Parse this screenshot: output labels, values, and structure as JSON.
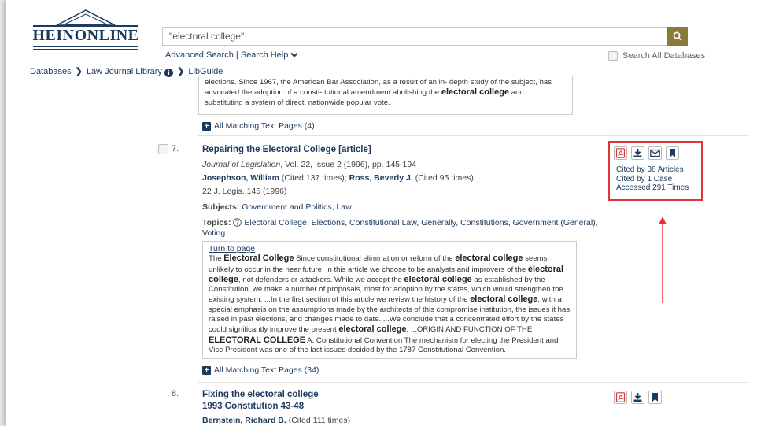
{
  "header": {
    "logo_text": "HEINONLINE",
    "search_value": "\"electoral college\"",
    "advanced_search": "Advanced Search",
    "link_separator": "|",
    "search_help": "Search Help",
    "search_all_label": "Search All Databases"
  },
  "breadcrumb": {
    "databases": "Databases",
    "library": "Law Journal Library",
    "libguide": "LibGuide"
  },
  "prev_result": {
    "snippet_line1": "elections. Since 1967, the American Bar Association, as a result of an in- depth study of the subject, has",
    "snippet_line2": "advocated the adoption of a consti- tutional amendment abolishing the",
    "snippet_kw": "electoral college",
    "snippet_line2b": "and",
    "snippet_line3": "substituting a system of direct, nationwide popular vote.",
    "more": "All Matching Text Pages (4)"
  },
  "result7": {
    "number": "7.",
    "title": "Repairing the Electoral College [article]",
    "journal": "Journal of Legislation",
    "journal_details": ", Vol. 22, Issue 2 (1996), pp. 145-194",
    "author1": "Josephson, William",
    "author1_cited": "(Cited 137 times);",
    "author2": "Ross, Beverly J.",
    "author2_cited": "(Cited 95 times)",
    "citation": "22 J. Legis. 145 (1996)",
    "subjects_label": "Subjects:",
    "subjects": "Government and Politics, Law",
    "topics_label": "Topics:",
    "topics_line1": "Electoral College, Elections, Constitutional Law, Generally, Constitutions, Government (General),",
    "topics_line2": "Voting",
    "turn_to_page": "Turn to page",
    "snippet": [
      {
        "t": "The "
      },
      {
        "k": "Electoral College"
      },
      {
        "t": " Since constitutional elimination or reform of the "
      },
      {
        "k": "electoral college"
      },
      {
        "t": " seems unlikely to occur in the near future, in this article we choose to be analysts and improvers of the "
      },
      {
        "k": "electoral college"
      },
      {
        "t": ", not defenders or attackers. While we accept the "
      },
      {
        "k": "electoral college"
      },
      {
        "t": " as established by the Constitution, we make a number of proposals, most for adoption by the states, which would strengthen the existing system. ...In the first section of this article we review the history of the "
      },
      {
        "k": "electoral college"
      },
      {
        "t": ", with a special emphasis on the assumptions made by the architects of this compromise institution, the issues it has raised in past elections, and changes made to date. ...We conclude that a concentrated effort by the states could significantly improve the present "
      },
      {
        "k": "electoral college"
      },
      {
        "t": ". ...ORIGIN AND FUNCTION OF THE "
      },
      {
        "k": "ELECTORAL COLLEGE"
      },
      {
        "t": " A. Constitutional Convention The mechanism for electing the President and Vice President was one of the last issues decided by the 1787 Constitutional Convention."
      }
    ],
    "more": "All Matching Text Pages (34)",
    "cited_articles": "Cited by 38 Articles",
    "cited_case": "Cited by 1 Case",
    "accessed": "Accessed 291 Times"
  },
  "result8": {
    "number": "8.",
    "title": "Fixing the electoral college",
    "subtitle": "1993 Constitution 43-48",
    "author": "Bernstein, Richard B.",
    "author_cited": "(Cited 111 times)"
  },
  "colors": {
    "brand": "#1c3a5c",
    "search_button": "#8a7a3a",
    "highlight": "#d9353a",
    "pdf_icon": "#d9353a"
  },
  "icons": [
    "search-icon",
    "chevron-down-icon",
    "info-icon",
    "pdf-icon",
    "download-icon",
    "email-icon",
    "bookmark-icon",
    "help-circle-icon",
    "plus-icon",
    "arrow-up-icon"
  ]
}
